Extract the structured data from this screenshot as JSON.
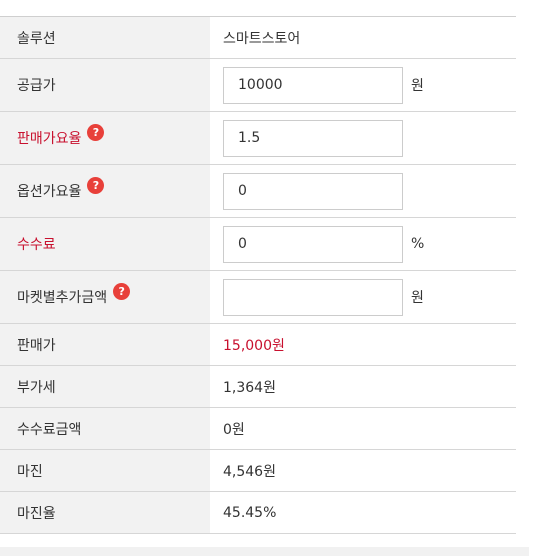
{
  "colors": {
    "label_bg": "#f2f2f2",
    "accent_red": "#c8102e",
    "help_icon": "#e8403a",
    "border": "#d6d6d6"
  },
  "rows": {
    "solution": {
      "label": "솔루션",
      "value": "스마트스토어"
    },
    "supply_price": {
      "label": "공급가",
      "value": "10000",
      "unit": "원"
    },
    "sale_ratio": {
      "label": "판매가요율",
      "value": "1.5",
      "help_icon": "question-icon",
      "help_glyph": "?"
    },
    "option_ratio": {
      "label": "옵션가요율",
      "value": "0",
      "help_icon": "question-icon",
      "help_glyph": "?"
    },
    "fee": {
      "label": "수수료",
      "value": "0",
      "unit": "%"
    },
    "market_extra": {
      "label": "마켓별추가금액",
      "value": "",
      "unit": "원",
      "help_icon": "question-icon",
      "help_glyph": "?"
    },
    "sale_price": {
      "label": "판매가",
      "value": "15,000원"
    },
    "vat": {
      "label": "부가세",
      "value": "1,364원"
    },
    "fee_amount": {
      "label": "수수료금액",
      "value": "0원"
    },
    "margin": {
      "label": "마진",
      "value": "4,546원"
    },
    "margin_rate": {
      "label": "마진율",
      "value": "45.45%"
    }
  }
}
